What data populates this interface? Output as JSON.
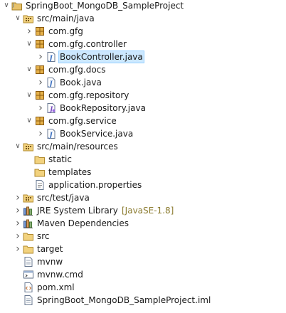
{
  "tree": [
    {
      "depth": 0,
      "arrow": "down",
      "icon": "java-project-icon",
      "label": "SpringBoot_MongoDB_SampleProject",
      "decoration": ""
    },
    {
      "depth": 1,
      "arrow": "down",
      "icon": "source-folder-icon",
      "label": "src/main/java",
      "decoration": ""
    },
    {
      "depth": 2,
      "arrow": "right",
      "icon": "package-icon",
      "label": "com.gfg",
      "decoration": ""
    },
    {
      "depth": 2,
      "arrow": "down",
      "icon": "package-icon",
      "label": "com.gfg.controller",
      "decoration": ""
    },
    {
      "depth": 3,
      "arrow": "right",
      "icon": "java-file-icon",
      "label": "BookController.java",
      "decoration": "",
      "selected": true
    },
    {
      "depth": 2,
      "arrow": "down",
      "icon": "package-icon",
      "label": "com.gfg.docs",
      "decoration": ""
    },
    {
      "depth": 3,
      "arrow": "right",
      "icon": "java-file-icon",
      "label": "Book.java",
      "decoration": ""
    },
    {
      "depth": 2,
      "arrow": "down",
      "icon": "package-icon",
      "label": "com.gfg.repository",
      "decoration": ""
    },
    {
      "depth": 3,
      "arrow": "right",
      "icon": "java-interface-file-icon",
      "label": "BookRepository.java",
      "decoration": ""
    },
    {
      "depth": 2,
      "arrow": "down",
      "icon": "package-icon",
      "label": "com.gfg.service",
      "decoration": ""
    },
    {
      "depth": 3,
      "arrow": "right",
      "icon": "java-file-icon",
      "label": "BookService.java",
      "decoration": ""
    },
    {
      "depth": 1,
      "arrow": "down",
      "icon": "source-folder-icon",
      "label": "src/main/resources",
      "decoration": ""
    },
    {
      "depth": 2,
      "arrow": "none",
      "icon": "folder-icon",
      "label": "static",
      "decoration": ""
    },
    {
      "depth": 2,
      "arrow": "none",
      "icon": "folder-icon",
      "label": "templates",
      "decoration": ""
    },
    {
      "depth": 2,
      "arrow": "none",
      "icon": "properties-file-icon",
      "label": "application.properties",
      "decoration": ""
    },
    {
      "depth": 1,
      "arrow": "right",
      "icon": "source-folder-icon",
      "label": "src/test/java",
      "decoration": ""
    },
    {
      "depth": 1,
      "arrow": "right",
      "icon": "library-icon",
      "label": "JRE System Library",
      "decoration": "[JavaSE-1.8]"
    },
    {
      "depth": 1,
      "arrow": "right",
      "icon": "library-icon",
      "label": "Maven Dependencies",
      "decoration": ""
    },
    {
      "depth": 1,
      "arrow": "right",
      "icon": "folder-icon",
      "label": "src",
      "decoration": ""
    },
    {
      "depth": 1,
      "arrow": "right",
      "icon": "folder-icon",
      "label": "target",
      "decoration": ""
    },
    {
      "depth": 1,
      "arrow": "none",
      "icon": "text-file-icon",
      "label": "mvnw",
      "decoration": ""
    },
    {
      "depth": 1,
      "arrow": "none",
      "icon": "cmd-file-icon",
      "label": "mvnw.cmd",
      "decoration": ""
    },
    {
      "depth": 1,
      "arrow": "none",
      "icon": "xml-file-icon",
      "label": "pom.xml",
      "decoration": ""
    },
    {
      "depth": 1,
      "arrow": "none",
      "icon": "text-file-icon",
      "label": "SpringBoot_MongoDB_SampleProject.iml",
      "decoration": ""
    }
  ]
}
